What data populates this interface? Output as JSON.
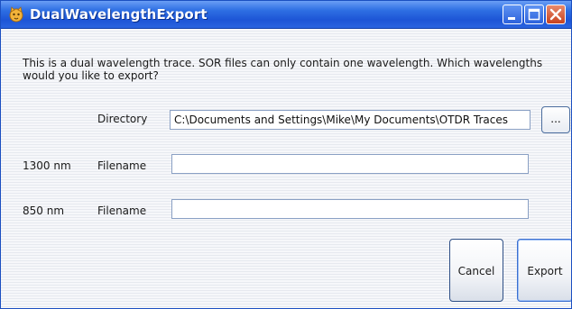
{
  "window": {
    "title": "DualWavelengthExport",
    "title_bar_color": "#2a64df"
  },
  "message": "This is a dual wavelength trace. SOR files can only contain one wavelength.  Which wavelengths would you like to export?",
  "directory": {
    "label": "Directory",
    "value": "C:\\Documents and Settings\\Mike\\My Documents\\OTDR Traces",
    "browse_label": "..."
  },
  "rows": [
    {
      "wavelength": "1300 nm",
      "label": "Filename",
      "value": ""
    },
    {
      "wavelength": "850 nm",
      "label": "Filename",
      "value": ""
    }
  ],
  "buttons": {
    "cancel": "Cancel",
    "export": "Export"
  }
}
